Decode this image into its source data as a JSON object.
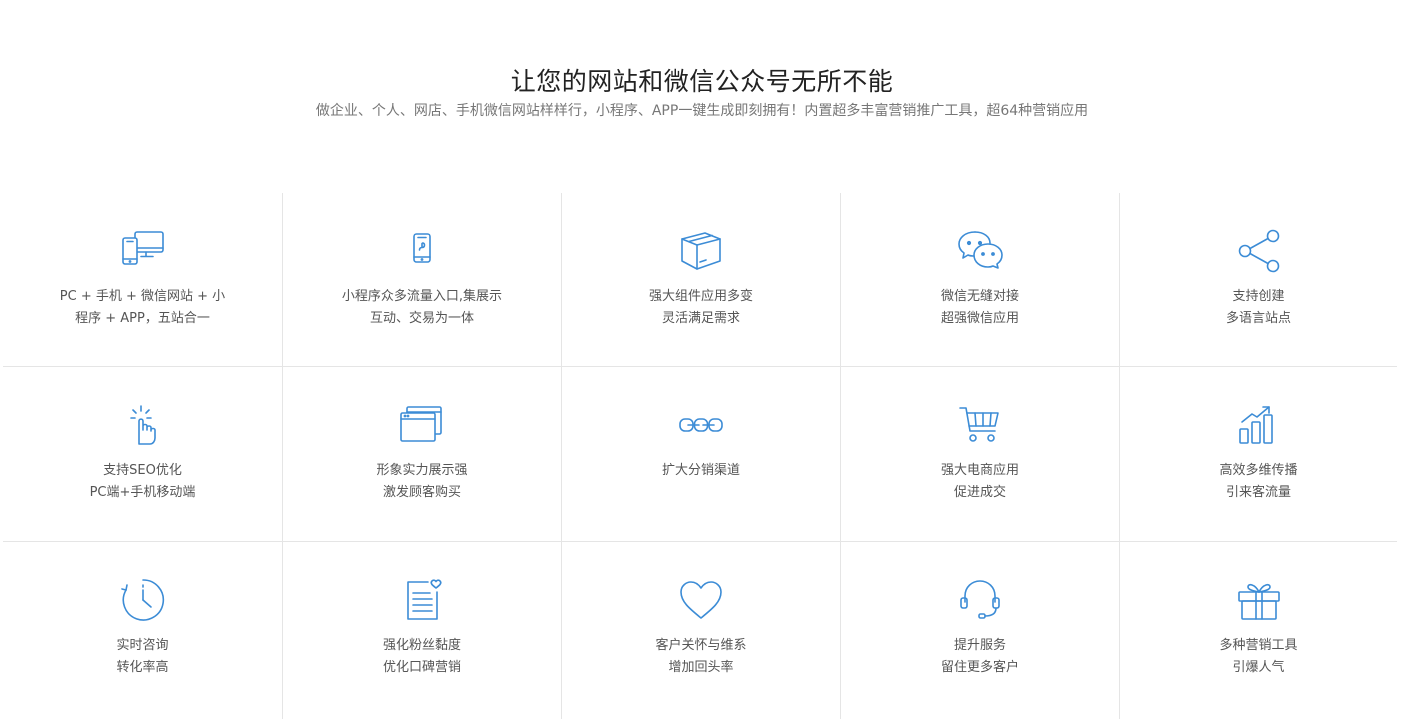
{
  "header": {
    "title": "让您的网站和微信公众号无所不能",
    "subtitle": "做企业、个人、网店、手机微信网站样样行，小程序、APP一键生成即刻拥有！内置超多丰富营销推广工具，超64种营销应用"
  },
  "accent_color": "#3c8cd6",
  "features": [
    {
      "icon": "devices-icon",
      "line1": "PC + 手机 + 微信网站 + 小",
      "line2": "程序 + APP，五站合一"
    },
    {
      "icon": "mini-program-phone-icon",
      "line1": "小程序众多流量入口,集展示",
      "line2": "互动、交易为一体"
    },
    {
      "icon": "box-icon",
      "line1": "强大组件应用多变",
      "line2": "灵活满足需求"
    },
    {
      "icon": "wechat-icon",
      "line1": "微信无缝对接",
      "line2": "超强微信应用"
    },
    {
      "icon": "share-icon",
      "line1": "支持创建",
      "line2": "多语言站点"
    },
    {
      "icon": "click-hand-icon",
      "line1": "支持SEO优化",
      "line2": "PC端+手机移动端"
    },
    {
      "icon": "windows-icon",
      "line1": "形象实力展示强",
      "line2": "激发顾客购买"
    },
    {
      "icon": "chain-icon",
      "line1": "扩大分销渠道",
      "line2": ""
    },
    {
      "icon": "cart-icon",
      "line1": "强大电商应用",
      "line2": "促进成交"
    },
    {
      "icon": "growth-chart-icon",
      "line1": "高效多维传播",
      "line2": "引来客流量"
    },
    {
      "icon": "clock-icon",
      "line1": "实时咨询",
      "line2": "转化率高"
    },
    {
      "icon": "document-heart-icon",
      "line1": "强化粉丝黏度",
      "line2": "优化口碑营销"
    },
    {
      "icon": "heart-icon",
      "line1": "客户关怀与维系",
      "line2": "增加回头率"
    },
    {
      "icon": "headset-icon",
      "line1": "提升服务",
      "line2": "留住更多客户"
    },
    {
      "icon": "gift-icon",
      "line1": "多种营销工具",
      "line2": "引爆人气"
    }
  ]
}
